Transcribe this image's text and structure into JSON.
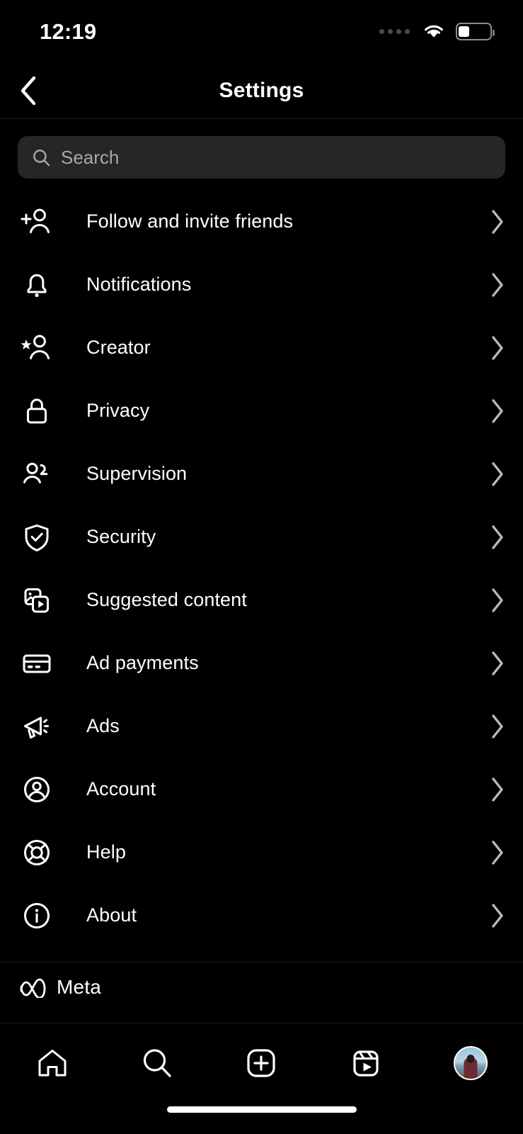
{
  "status_bar": {
    "time": "12:19",
    "signal_dots": 4,
    "wifi_icon": "wifi-icon",
    "battery_icon": "battery-icon",
    "battery_level_percent": 35
  },
  "header": {
    "title": "Settings",
    "back_icon": "chevron-left-icon"
  },
  "search": {
    "placeholder": "Search",
    "value": "",
    "icon": "search-icon"
  },
  "settings_list": [
    {
      "label": "Follow and invite friends",
      "icon": "person-add-icon",
      "chevron": "chevron-right-icon"
    },
    {
      "label": "Notifications",
      "icon": "bell-icon",
      "chevron": "chevron-right-icon"
    },
    {
      "label": "Creator",
      "icon": "person-star-icon",
      "chevron": "chevron-right-icon"
    },
    {
      "label": "Privacy",
      "icon": "lock-icon",
      "chevron": "chevron-right-icon"
    },
    {
      "label": "Supervision",
      "icon": "people-icon",
      "chevron": "chevron-right-icon"
    },
    {
      "label": "Security",
      "icon": "shield-check-icon",
      "chevron": "chevron-right-icon"
    },
    {
      "label": "Suggested content",
      "icon": "media-stack-icon",
      "chevron": "chevron-right-icon"
    },
    {
      "label": "Ad payments",
      "icon": "credit-card-icon",
      "chevron": "chevron-right-icon"
    },
    {
      "label": "Ads",
      "icon": "megaphone-icon",
      "chevron": "chevron-right-icon"
    },
    {
      "label": "Account",
      "icon": "account-circle-icon",
      "chevron": "chevron-right-icon"
    },
    {
      "label": "Help",
      "icon": "life-ring-icon",
      "chevron": "chevron-right-icon"
    },
    {
      "label": "About",
      "icon": "info-circle-icon",
      "chevron": "chevron-right-icon"
    }
  ],
  "meta_section": {
    "label": "Meta",
    "icon": "meta-infinity-logo"
  },
  "bottom_nav": [
    {
      "name": "home",
      "icon": "home-icon"
    },
    {
      "name": "search",
      "icon": "search-icon"
    },
    {
      "name": "create",
      "icon": "plus-square-icon"
    },
    {
      "name": "reels",
      "icon": "reels-icon"
    },
    {
      "name": "profile",
      "icon": "profile-avatar"
    }
  ],
  "colors": {
    "background": "#000000",
    "search_field": "#262626",
    "divider": "#1c1c1c",
    "text_primary": "#ffffff",
    "text_placeholder": "#a8a8a8"
  }
}
